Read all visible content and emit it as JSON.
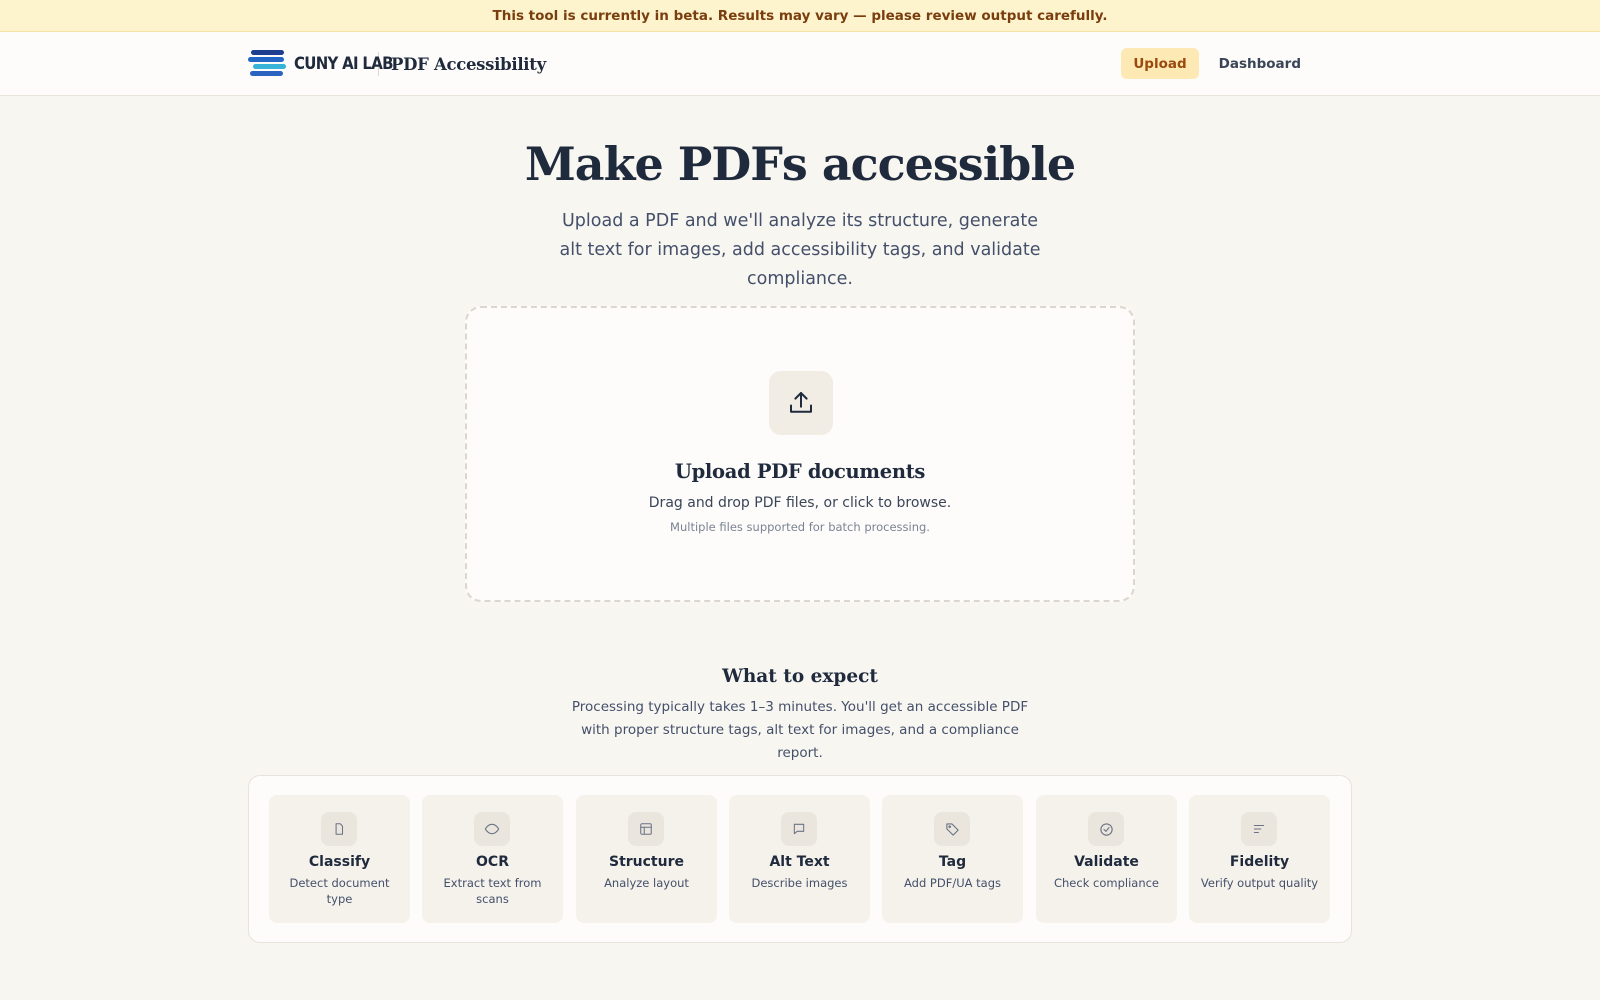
{
  "banner": {
    "text": "This tool is currently in beta. Results may vary — please review output carefully."
  },
  "header": {
    "logo_text": "CUNY AI LAB",
    "app_title": "PDF Accessibility",
    "nav": [
      {
        "label": "Upload",
        "active": true
      },
      {
        "label": "Dashboard",
        "active": false
      }
    ]
  },
  "hero": {
    "title": "Make PDFs accessible",
    "subtitle": "Upload a PDF and we'll analyze its structure, generate alt text for images, add accessibility tags, and validate compliance."
  },
  "dropzone": {
    "icon": "upload-icon",
    "title": "Upload PDF documents",
    "instructions": "Drag and drop PDF files, or click to browse.",
    "note": "Multiple files supported for batch processing."
  },
  "expect": {
    "title": "What to expect",
    "description": "Processing typically takes 1–3 minutes. You'll get an accessible PDF with proper structure tags, alt text for images, and a compliance report."
  },
  "steps": [
    {
      "name": "Classify",
      "description": "Detect document type",
      "icon": "document-icon"
    },
    {
      "name": "OCR",
      "description": "Extract text from scans",
      "icon": "eye-icon"
    },
    {
      "name": "Structure",
      "description": "Analyze layout",
      "icon": "layout-icon"
    },
    {
      "name": "Alt Text",
      "description": "Describe images",
      "icon": "message-icon"
    },
    {
      "name": "Tag",
      "description": "Add PDF/UA tags",
      "icon": "tag-icon"
    },
    {
      "name": "Validate",
      "description": "Check compliance",
      "icon": "check-circle-icon"
    },
    {
      "name": "Fidelity",
      "description": "Verify output quality",
      "icon": "lines-icon"
    }
  ],
  "colors": {
    "background": "#f8f6f1",
    "banner_bg": "#fdf3cd",
    "banner_text": "#7a3e0e",
    "active_nav_bg": "#fde9b3",
    "active_nav_text": "#9a4a0e",
    "heading": "#1f2a3d"
  }
}
